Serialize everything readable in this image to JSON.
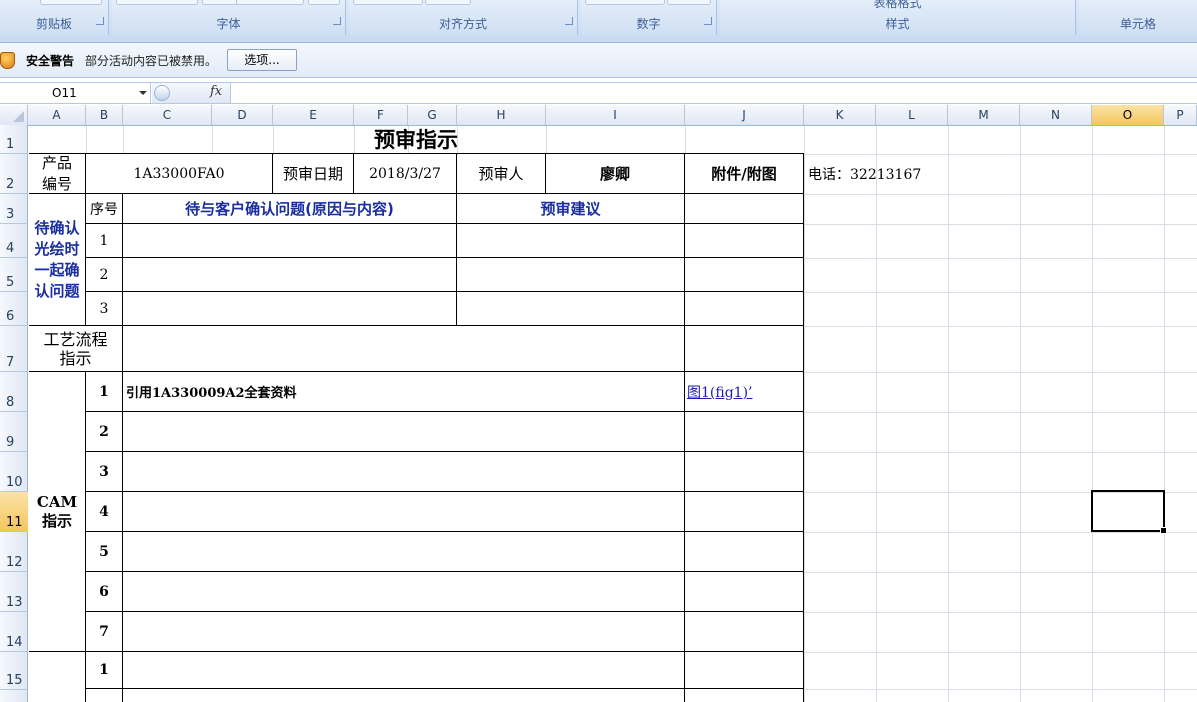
{
  "ribbon": {
    "groups": [
      {
        "label": "剪贴板"
      },
      {
        "label": "字体"
      },
      {
        "label": "对齐方式"
      },
      {
        "label": "数字"
      },
      {
        "label": "样式",
        "top_fragment": "表格格式"
      },
      {
        "label": "单元格"
      }
    ]
  },
  "security": {
    "title": "安全警告",
    "message": "部分活动内容已被禁用。",
    "options_button": "选项..."
  },
  "formula_bar": {
    "name_box": "O11",
    "fx_label": "fx",
    "formula": ""
  },
  "columns": [
    "A",
    "B",
    "C",
    "D",
    "E",
    "F",
    "G",
    "H",
    "I",
    "J",
    "K",
    "L",
    "M",
    "N",
    "O",
    "P"
  ],
  "selected_column": "O",
  "rows": [
    "1",
    "2",
    "3",
    "4",
    "5",
    "6",
    "7",
    "8",
    "9",
    "10",
    "11",
    "12",
    "13",
    "14",
    "15"
  ],
  "selected_row": "11",
  "sheet": {
    "title": "预审指示",
    "product_no_label": "产品\n编号",
    "product_no": "1A33000FA0",
    "review_date_label": "预审日期",
    "review_date": "2018/3/27",
    "reviewer_label": "预审人",
    "reviewer": "廖卿",
    "attachment_label": "附件/附图",
    "phone": "电话：32213167",
    "confirm_section_label": "待确认\n光绘时\n一起确\n认问题",
    "seq_label": "序号",
    "confirm_header": "待与客户确认问题(原因与内容)",
    "suggestion_header": "预审建议",
    "confirm_rows": [
      "1",
      "2",
      "3"
    ],
    "process_label": "工艺流程\n指示",
    "cam_label": "CAM\n指示",
    "cam_rows": [
      {
        "no": "1",
        "text": "引用1A330009A2全套资料",
        "attachment": "图1(fig1)’"
      },
      {
        "no": "2",
        "text": "",
        "attachment": ""
      },
      {
        "no": "3",
        "text": "",
        "attachment": ""
      },
      {
        "no": "4",
        "text": "",
        "attachment": ""
      },
      {
        "no": "5",
        "text": "",
        "attachment": ""
      },
      {
        "no": "6",
        "text": "",
        "attachment": ""
      },
      {
        "no": "7",
        "text": "",
        "attachment": ""
      }
    ],
    "next_section_first_no": "1"
  }
}
